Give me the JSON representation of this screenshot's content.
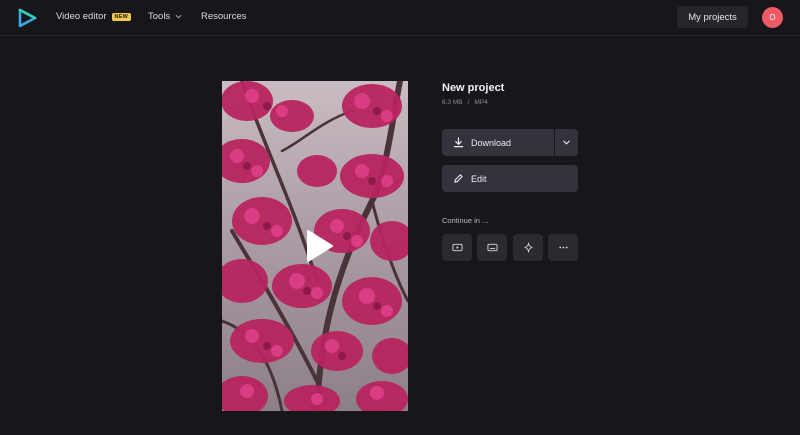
{
  "header": {
    "nav": {
      "video_editor": "Video editor",
      "new_badge": "NEW",
      "tools": "Tools",
      "resources": "Resources"
    },
    "my_projects": "My projects",
    "avatar_initial": "O"
  },
  "project": {
    "title": "New project",
    "size": "6.3 MB",
    "separator": "/",
    "format": "MP4"
  },
  "actions": {
    "download_label": "Download",
    "edit_label": "Edit",
    "continue_label": "Continue in ..."
  },
  "continue_icons": [
    "youtube-icon",
    "subtitles-icon",
    "sparkle-icon",
    "more-dots-icon"
  ],
  "colors": {
    "background": "#17161b",
    "button": "#34333b",
    "badge": "#f2c94c",
    "avatar": "#ec5a66",
    "logo_blue": "#3aa7e8",
    "logo_teal": "#36d1b3"
  }
}
